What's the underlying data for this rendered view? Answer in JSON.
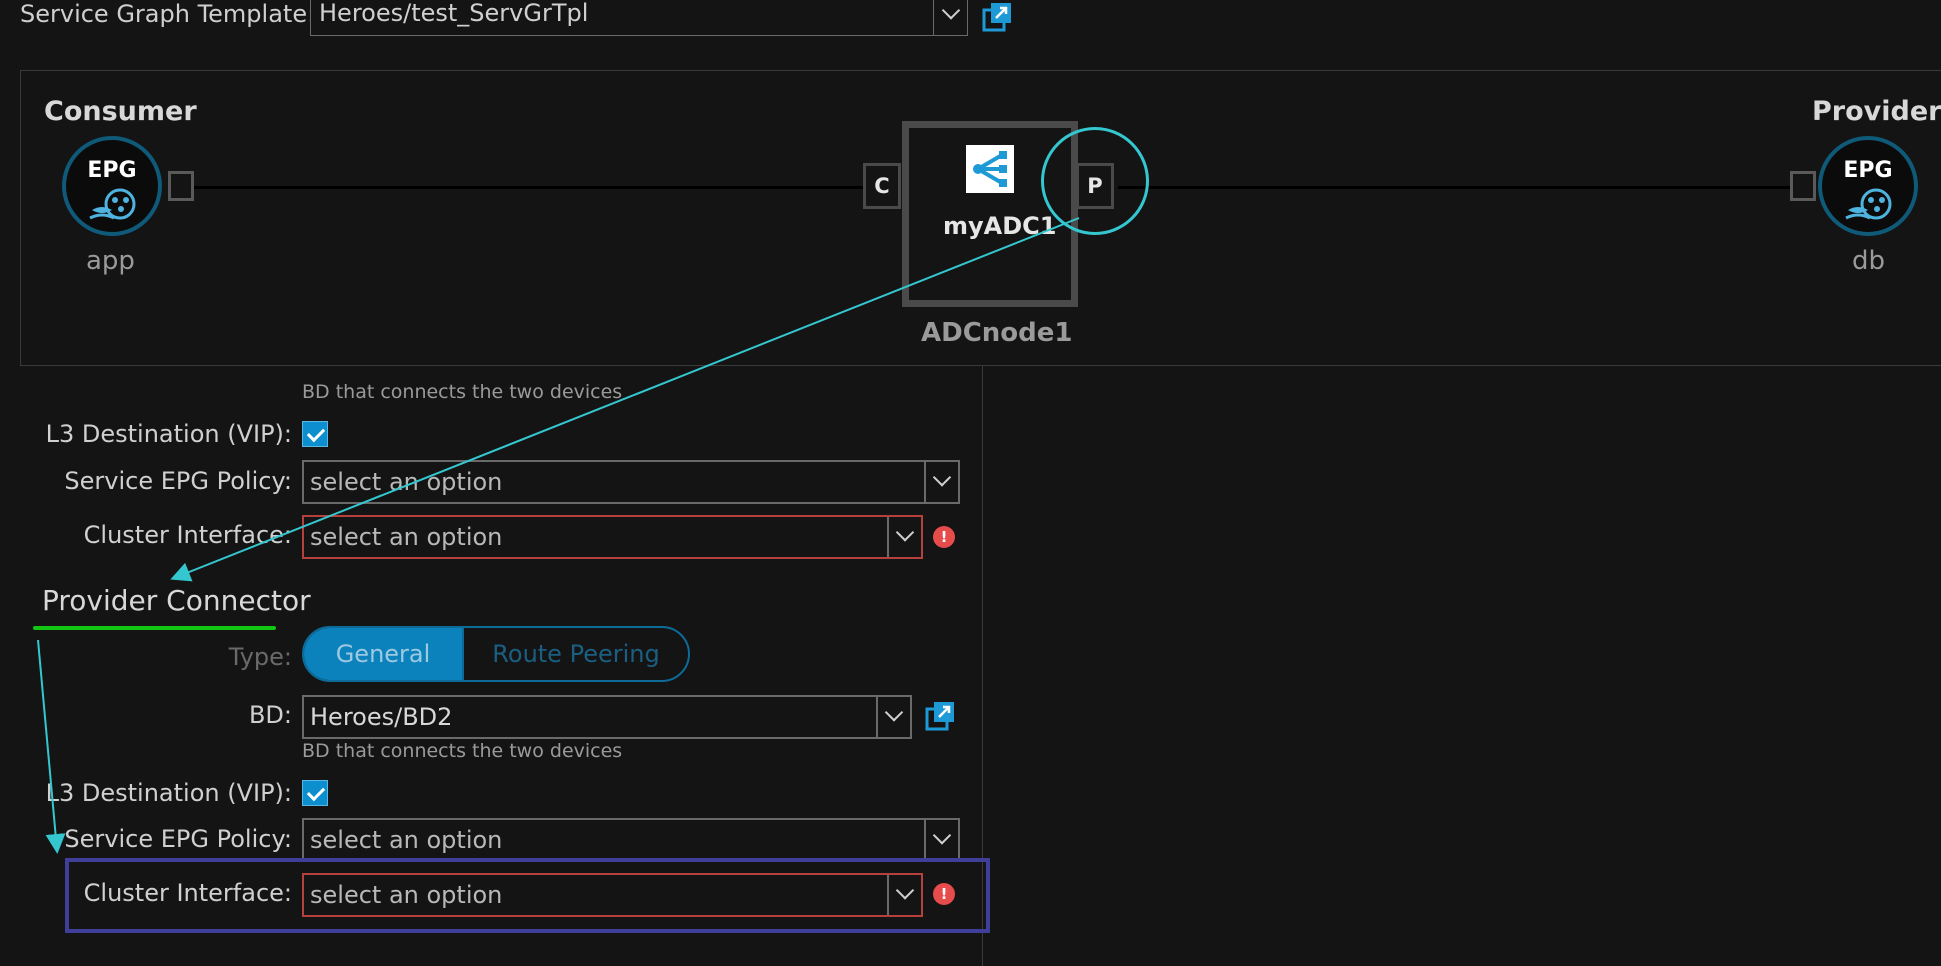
{
  "template": {
    "label": "Service Graph Template:",
    "value": "Heroes/test_ServGrTpl"
  },
  "graph": {
    "consumer_title": "Consumer",
    "provider_title": "Provider",
    "consumer_epg": {
      "badge": "EPG",
      "name": "app"
    },
    "provider_epg": {
      "badge": "EPG",
      "name": "db"
    },
    "node": {
      "name": "myADC1",
      "label": "ADCnode1",
      "consumer_port": "C",
      "provider_port": "P"
    }
  },
  "consumer_section": {
    "bd_hint": "BD that connects the two devices",
    "l3_label": "L3 Destination (VIP):",
    "l3_checked": true,
    "epg_policy_label": "Service EPG Policy:",
    "epg_policy_value": "select an option",
    "cluster_label": "Cluster Interface:",
    "cluster_value": "select an option",
    "error_glyph": "!"
  },
  "provider_section": {
    "title": "Provider Connector",
    "type_label": "Type:",
    "type_options": [
      "General",
      "Route Peering"
    ],
    "type_selected": "General",
    "bd_label": "BD:",
    "bd_value": "Heroes/BD2",
    "bd_hint": "BD that connects the two devices",
    "l3_label": "L3 Destination (VIP):",
    "l3_checked": true,
    "epg_policy_label": "Service EPG Policy:",
    "epg_policy_value": "select an option",
    "cluster_label": "Cluster Interface:",
    "cluster_value": "select an option",
    "error_glyph": "!"
  },
  "icons": [
    "external-link-icon",
    "epg-icon",
    "load-balancer-icon",
    "chevron-down-icon",
    "error-icon",
    "checkbox-checked-icon"
  ],
  "colors": {
    "accent": "#0c82bd",
    "annotation_cyan": "#35c7d0",
    "annotation_green": "#13c613",
    "annotation_blue": "#3f3f9a",
    "error": "#e64c4c"
  }
}
